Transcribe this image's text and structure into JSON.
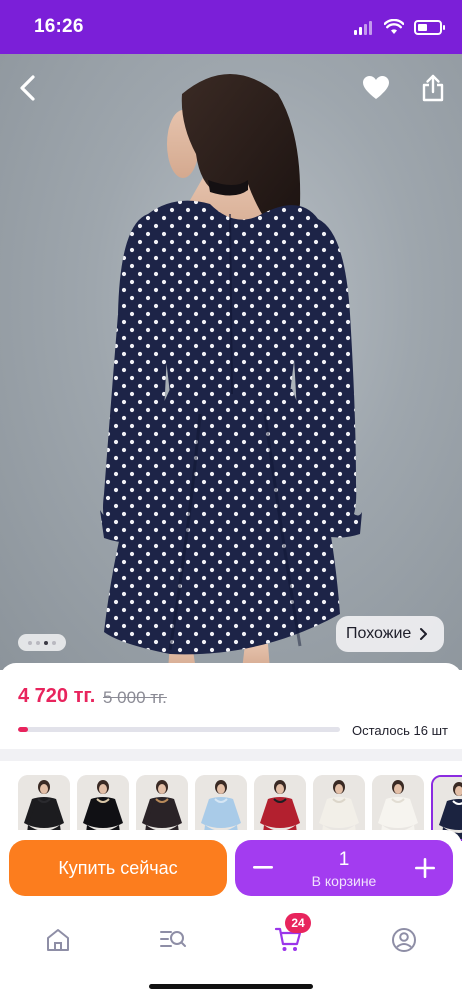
{
  "status_bar": {
    "time": "16:26",
    "battery_level": 0.45
  },
  "product": {
    "price": "4 720 тг.",
    "old_price": "5 000 тг.",
    "stock_text": "Осталось 16 шт",
    "stock_progress": 0.03,
    "similar_label": "Похожие",
    "photo_count": 4,
    "active_photo": 2
  },
  "variants": [
    {
      "color": "#1c1c1f",
      "accent": "#2a2a2e"
    },
    {
      "color": "#101014",
      "accent": "#d9c7a8"
    },
    {
      "color": "#2a2327",
      "accent": "#b88a5a"
    },
    {
      "color": "#a9cbe8",
      "accent": "#d6e6f4"
    },
    {
      "color": "#b3202f",
      "accent": "#1e1e22"
    },
    {
      "color": "#f2efe8",
      "accent": "#dcd6ca"
    },
    {
      "color": "#f6f4ef",
      "accent": "#e2ddd3"
    },
    {
      "color": "#1b2340",
      "accent": "#ffffff"
    }
  ],
  "actions": {
    "buy_label": "Купить сейчас",
    "quantity": "1",
    "cart_caption": "В корзине"
  },
  "tab_bar": {
    "items": [
      "home-icon",
      "catalog-search-icon",
      "cart-icon",
      "profile-icon"
    ],
    "cart_badge": "24",
    "active": "cart-icon"
  },
  "colors": {
    "brand_purple": "#7b1fd8",
    "cart_purple": "#a33cf0",
    "buy_orange": "#fc7d1e",
    "price_pink": "#e8245d"
  }
}
